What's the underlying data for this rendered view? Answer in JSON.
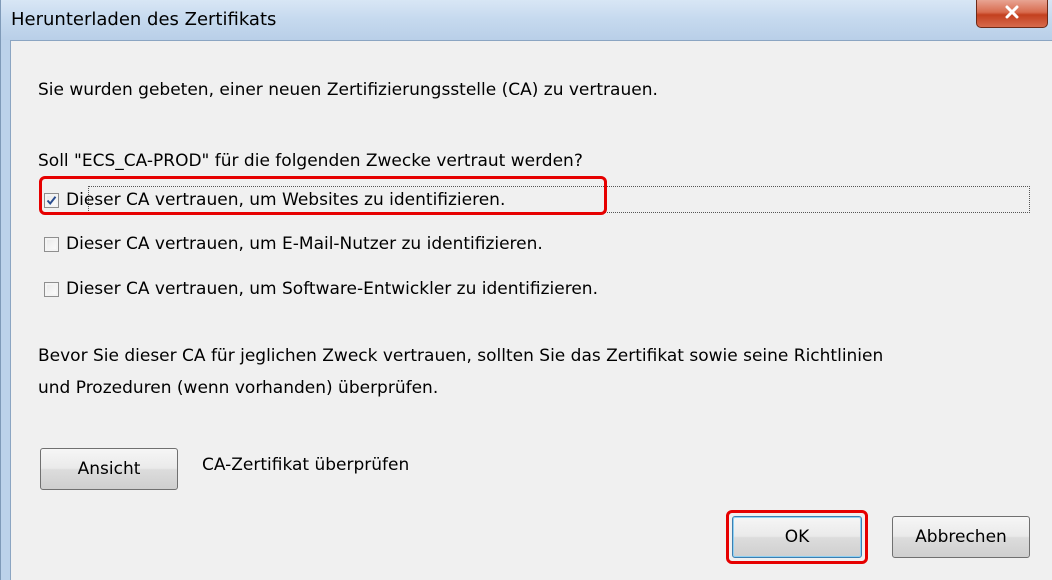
{
  "window": {
    "title": "Herunterladen des Zertifikats",
    "close_icon": "close-icon"
  },
  "dialog": {
    "intro": "Sie wurden gebeten, einer neuen Zertifizierungsstelle (CA) zu vertrauen.",
    "question": "Soll \"ECS_CA-PROD\" für die folgenden Zwecke vertraut werden?",
    "options": [
      {
        "label": "Dieser CA vertrauen, um Websites zu identifizieren.",
        "checked": true
      },
      {
        "label": "Dieser CA vertrauen, um E-Mail-Nutzer zu identifizieren.",
        "checked": false
      },
      {
        "label": "Dieser CA vertrauen, um Software-Entwickler zu identifizieren.",
        "checked": false
      }
    ],
    "warning_line1": "Bevor Sie dieser CA für jeglichen Zweck vertrauen, sollten Sie das Zertifikat sowie seine Richtlinien",
    "warning_line2": "und Prozeduren (wenn vorhanden) überprüfen.",
    "view_button": "Ansicht",
    "view_label": "CA-Zertifikat überprüfen",
    "ok_button": "OK",
    "cancel_button": "Abbrechen"
  },
  "colors": {
    "highlight": "#e60000",
    "dialog_bg": "#f0f0f0",
    "close_button": "#c3401f"
  }
}
